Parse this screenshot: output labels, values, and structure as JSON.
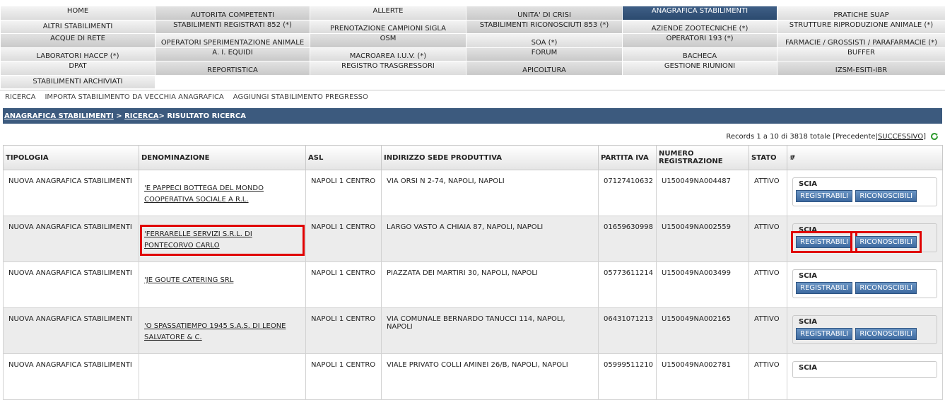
{
  "menu": {
    "items": [
      {
        "label": "HOME",
        "style": "up"
      },
      {
        "label": "AUTORITA COMPETENTI",
        "style": "dark down"
      },
      {
        "label": "ALLERTE",
        "style": "up"
      },
      {
        "label": "UNITA' DI CRISI",
        "style": "dark down"
      },
      {
        "label": "ANAGRAFICA STABILIMENTI",
        "style": "active up"
      },
      {
        "label": "PRATICHE SUAP",
        "style": "down"
      },
      {
        "label": "ALTRI STABILIMENTI",
        "style": ""
      },
      {
        "label": "STABILIMENTI REGISTRATI 852 (*)",
        "style": "dark up"
      },
      {
        "label": "PRENOTAZIONE CAMPIONI SIGLA",
        "style": "down"
      },
      {
        "label": "STABILIMENTI RICONOSCIUTI 853 (*)",
        "style": "dark up"
      },
      {
        "label": "AZIENDE ZOOTECNICHE (*)",
        "style": "down"
      },
      {
        "label": "STRUTTURE RIPRODUZIONE ANIMALE (*)",
        "style": "up"
      },
      {
        "label": "ACQUE DI RETE",
        "style": "dark up"
      },
      {
        "label": "OPERATORI SPERIMENTAZIONE ANIMALE",
        "style": "down"
      },
      {
        "label": "OSM",
        "style": "dark up"
      },
      {
        "label": "SOA (*)",
        "style": "down"
      },
      {
        "label": "OPERATORI 193 (*)",
        "style": "dark up"
      },
      {
        "label": "FARMACIE / GROSSISTI / PARAFARMACIE (*)",
        "style": "down"
      },
      {
        "label": "LABORATORI HACCP (*)",
        "style": "down"
      },
      {
        "label": "A. I. EQUIDI",
        "style": "dark up"
      },
      {
        "label": "MACROAREA I.U.V. (*)",
        "style": "down"
      },
      {
        "label": "FORUM",
        "style": "dark up"
      },
      {
        "label": "BACHECA",
        "style": "down"
      },
      {
        "label": "BUFFER",
        "style": "up"
      },
      {
        "label": "DPAT",
        "style": "up"
      },
      {
        "label": "REPORTISTICA",
        "style": "dark down"
      },
      {
        "label": "REGISTRO TRASGRESSORI",
        "style": "up"
      },
      {
        "label": "APICOLTURA",
        "style": "dark down"
      },
      {
        "label": "GESTIONE RIUNIONI",
        "style": "up"
      },
      {
        "label": "IZSM-ESITI-IBR",
        "style": "dark down"
      },
      {
        "label": "STABILIMENTI ARCHIVIATI",
        "style": ""
      }
    ]
  },
  "subnav": {
    "ricerca": "RICERCA",
    "importa": "IMPORTA STABILIMENTO DA VECCHIA ANAGRAFICA",
    "aggiungi": "AGGIUNGI STABILIMENTO PREGRESSO"
  },
  "breadcrumb": {
    "anagrafica": "ANAGRAFICA STABILIMENTI",
    "sep1": " > ",
    "ricerca": "RICERCA",
    "current": "> RISULTATO RICERCA"
  },
  "records": {
    "text": "Records 1 a 10 di 3818 totale [Precedente|",
    "next": "SUCCESSIVO",
    "close": "]",
    "refresh_icon": "refresh-icon"
  },
  "table": {
    "headers": {
      "tipologia": "TIPOLOGIA",
      "denominazione": "DENOMINAZIONE",
      "asl": "ASL",
      "indirizzo": "INDIRIZZO SEDE PRODUTTIVA",
      "partita_iva": "PARTITA IVA",
      "numero": "NUMERO REGISTRAZIONE",
      "stato": "STATO",
      "hash": "#"
    },
    "scia_label": "SCIA",
    "btn_registrabili": "REGISTRABILI",
    "btn_riconoscibili": "RICONOSCIBILI",
    "rows": [
      {
        "tipologia": "NUOVA ANAGRAFICA STABILIMENTI",
        "denominazione": "'E PAPPECI BOTTEGA DEL MONDO COOPERATIVA SOCIALE A R.L.",
        "asl": "NAPOLI 1 CENTRO",
        "indirizzo": "VIA ORSI N 2-74, NAPOLI, NAPOLI",
        "partita_iva": "07127410632",
        "numero": "U150049NA004487",
        "stato": "ATTIVO"
      },
      {
        "tipologia": "NUOVA ANAGRAFICA STABILIMENTI",
        "denominazione": "'FERRARELLE SERVIZI S.R.L. DI PONTECORVO CARLO",
        "asl": "NAPOLI 1 CENTRO",
        "indirizzo": "LARGO VASTO A CHIAIA 87, NAPOLI, NAPOLI",
        "partita_iva": "01659630998",
        "numero": "U150049NA002559",
        "stato": "ATTIVO"
      },
      {
        "tipologia": "NUOVA ANAGRAFICA STABILIMENTI",
        "denominazione": "'JE GOUTE CATERING SRL",
        "asl": "NAPOLI 1 CENTRO",
        "indirizzo": "PIAZZATA DEI MARTIRI 30, NAPOLI, NAPOLI",
        "partita_iva": "05773611214",
        "numero": "U150049NA003499",
        "stato": "ATTIVO"
      },
      {
        "tipologia": "NUOVA ANAGRAFICA STABILIMENTI",
        "denominazione": "'O SPASSATIEMPO 1945 S.A.S. DI LEONE SALVATORE & C.",
        "asl": "NAPOLI 1 CENTRO",
        "indirizzo": "VIA COMUNALE BERNARDO TANUCCI 114, NAPOLI, NAPOLI",
        "partita_iva": "06431071213",
        "numero": "U150049NA002165",
        "stato": "ATTIVO"
      },
      {
        "tipologia": "NUOVA ANAGRAFICA STABILIMENTI",
        "denominazione": "",
        "asl": "NAPOLI 1 CENTRO",
        "indirizzo": "VIALE PRIVATO COLLI AMINEI 26/B, NAPOLI, NAPOLI",
        "partita_iva": "05999511210",
        "numero": "U150049NA002781",
        "stato": "ATTIVO"
      }
    ]
  }
}
